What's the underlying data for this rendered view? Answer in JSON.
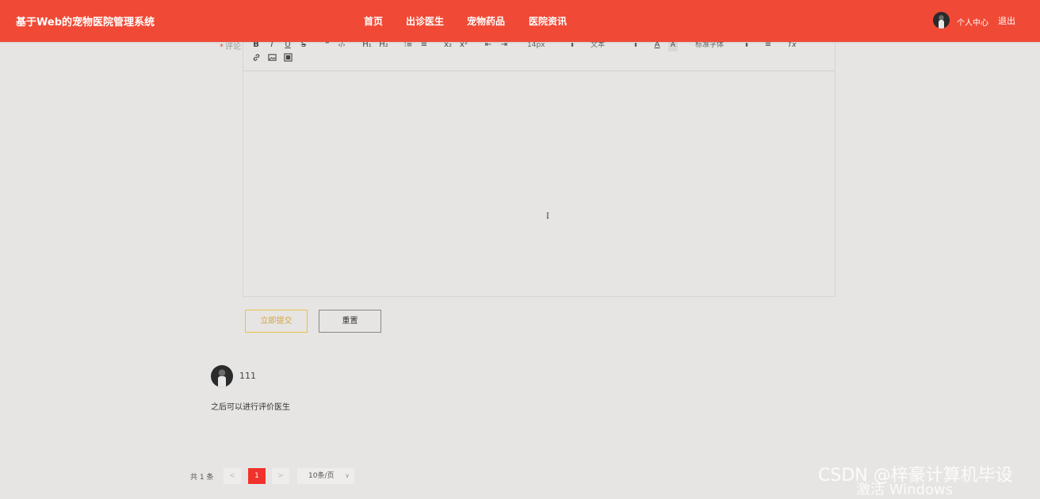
{
  "header": {
    "brand": "基于Web的宠物医院管理系统",
    "nav": [
      "首页",
      "出诊医生",
      "宠物药品",
      "医院资讯"
    ],
    "user_center": "个人中心",
    "logout": "退出"
  },
  "form": {
    "comment_label": "评论",
    "required_mark": "*",
    "toolbar": {
      "row1": [
        "B",
        "I",
        "U",
        "S",
        "❞",
        "‹/›",
        "H₁",
        "H₂",
        "⁝≡",
        "≡",
        "x₂",
        "x²",
        "⇤",
        "⇥",
        "A",
        "A",
        "≡",
        "Tx"
      ],
      "font_size": "14px",
      "block_type": "文本",
      "font_family": "标准字体",
      "row2_icons": [
        "link-icon",
        "image-icon",
        "video-icon"
      ]
    },
    "editor_content": "",
    "cursor_glyph": "I",
    "submit_label": "立即提交",
    "reset_label": "重置"
  },
  "comments": [
    {
      "user": "111",
      "text": "之后可以进行评价医生"
    }
  ],
  "pagination": {
    "total": "共 1 条",
    "prev": "<",
    "current": "1",
    "next": ">",
    "page_size": "10条/页"
  },
  "watermarks": {
    "csdn": "CSDN @梓豪计算机毕设",
    "windows": "激活 Windows"
  },
  "colors": {
    "header_bg": "#f04a36",
    "page_bg": "#e6e5e3",
    "pager_active": "#f0312c",
    "submit_border": "#e8c24a"
  }
}
